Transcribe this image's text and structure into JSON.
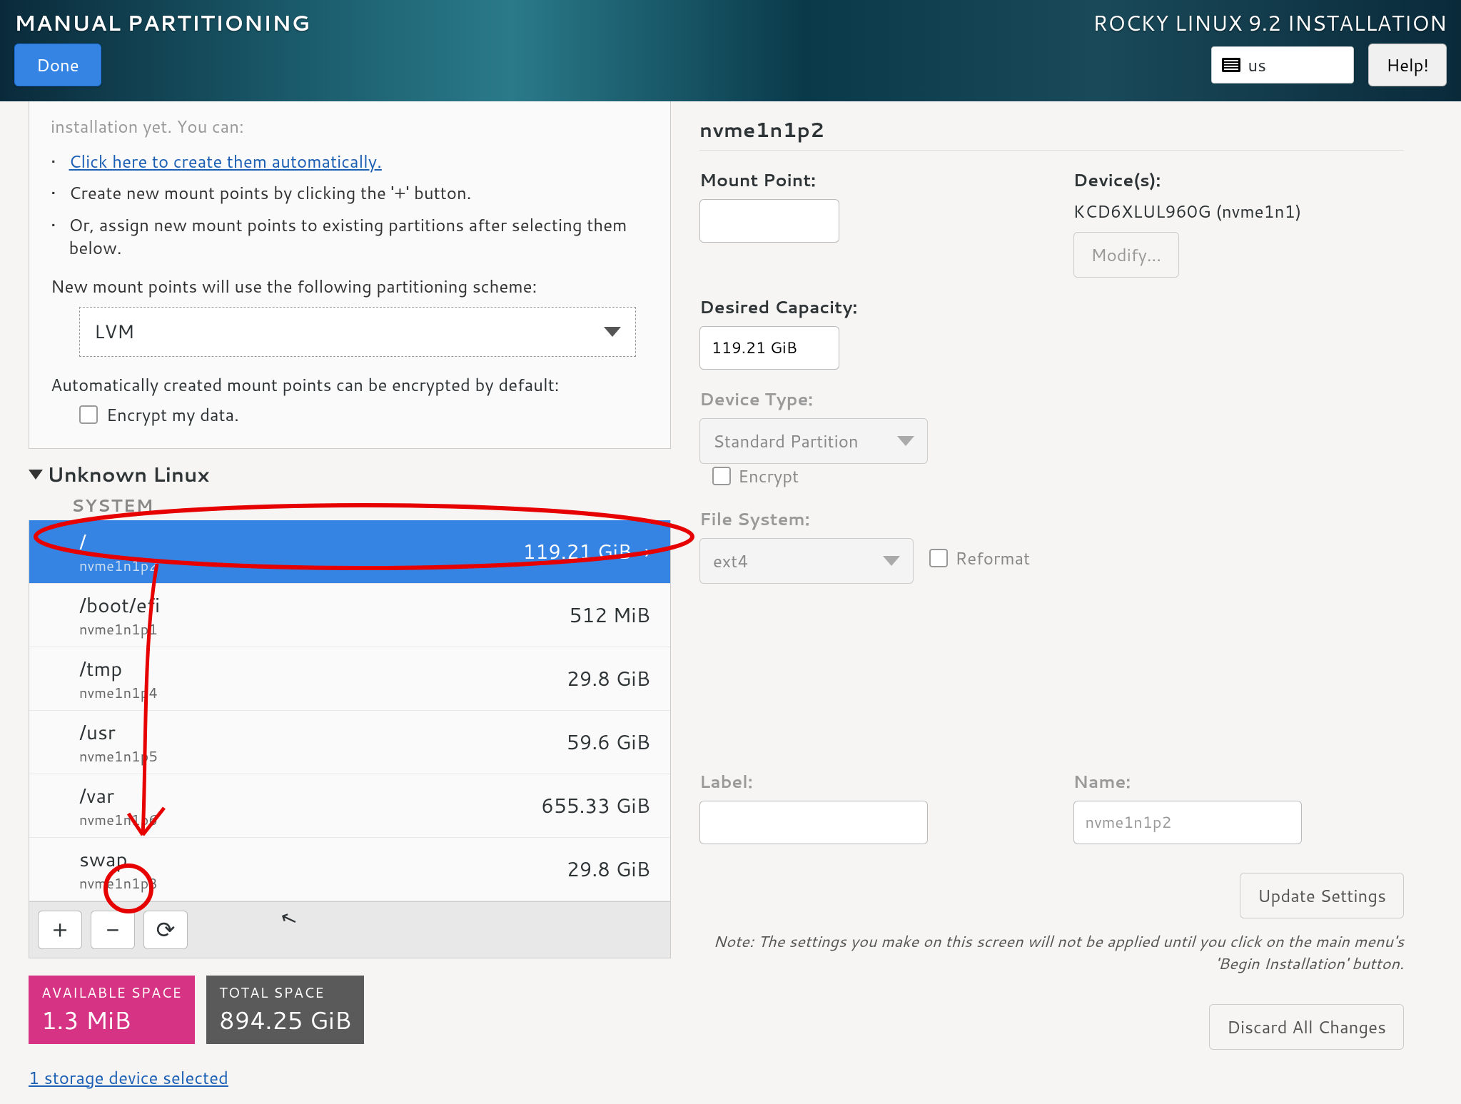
{
  "header": {
    "title": "MANUAL PARTITIONING",
    "done": "Done",
    "installer": "ROCKY LINUX 9.2 INSTALLATION",
    "keyboard": "us",
    "help": "Help!"
  },
  "intro": {
    "cutoff": "installation yet.  You can:",
    "auto_link": "Click here to create them automatically.",
    "create_new": "Create new mount points by clicking the '+' button.",
    "assign": "Or, assign new mount points to existing partitions after selecting them below.",
    "scheme_label": "New mount points will use the following partitioning scheme:",
    "scheme_value": "LVM",
    "encrypt_note": "Automatically created mount points can be encrypted by default:",
    "encrypt_check": "Encrypt my data."
  },
  "tree": {
    "group": "Unknown Linux",
    "subgroup": "SYSTEM",
    "items": [
      {
        "mount": "/",
        "device": "nvme1n1p2",
        "size": "119.21 GiB",
        "selected": true
      },
      {
        "mount": "/boot/efi",
        "device": "nvme1n1p1",
        "size": "512 MiB",
        "selected": false
      },
      {
        "mount": "/tmp",
        "device": "nvme1n1p4",
        "size": "29.8 GiB",
        "selected": false
      },
      {
        "mount": "/usr",
        "device": "nvme1n1p5",
        "size": "59.6 GiB",
        "selected": false
      },
      {
        "mount": "/var",
        "device": "nvme1n1p6",
        "size": "655.33 GiB",
        "selected": false
      },
      {
        "mount": "swap",
        "device": "nvme1n1p3",
        "size": "29.8 GiB",
        "selected": false
      }
    ]
  },
  "toolbar": {
    "add": "+",
    "remove": "−",
    "reload": "⟳"
  },
  "space": {
    "avail_label": "AVAILABLE SPACE",
    "avail_value": "1.3 MiB",
    "total_label": "TOTAL SPACE",
    "total_value": "894.25 GiB"
  },
  "storage_link": "1 storage device selected",
  "right": {
    "title": "nvme1n1p2",
    "mount_label": "Mount Point:",
    "mount_value": "",
    "capacity_label": "Desired Capacity:",
    "capacity_value": "119.21 GiB",
    "devices_label": "Device(s):",
    "devices_value": "KCD6XLUL960G (nvme1n1)",
    "modify": "Modify...",
    "devtype_label": "Device Type:",
    "devtype_value": "Standard Partition",
    "encrypt": "Encrypt",
    "fs_label": "File System:",
    "fs_value": "ext4",
    "reformat": "Reformat",
    "label_label": "Label:",
    "label_value": "",
    "name_label": "Name:",
    "name_value": "nvme1n1p2",
    "update": "Update Settings",
    "note": "Note:  The settings you make on this screen will not be applied until you click on the main menu's 'Begin Installation' button.",
    "discard": "Discard All Changes"
  }
}
